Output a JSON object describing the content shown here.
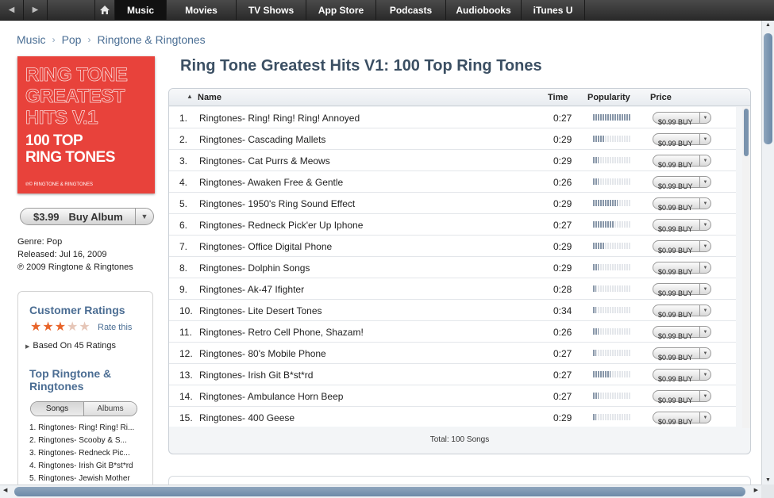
{
  "nav": {
    "back_icon": "◀",
    "forward_icon": "▶",
    "tabs": [
      {
        "label": "Music",
        "active": true
      },
      {
        "label": "Movies",
        "active": false
      },
      {
        "label": "TV Shows",
        "active": false
      },
      {
        "label": "App Store",
        "active": false
      },
      {
        "label": "Podcasts",
        "active": false
      },
      {
        "label": "Audiobooks",
        "active": false
      },
      {
        "label": "iTunes U",
        "active": false
      }
    ]
  },
  "breadcrumb": [
    "Music",
    "Pop",
    "Ringtone & Ringtones"
  ],
  "album": {
    "art_lines": [
      "RING TONE",
      "GREATEST",
      "HITS V.1",
      "100 TOP",
      "RING TONES"
    ],
    "art_small": "℗© RINGTONE & RINGTONES",
    "price": "$3.99",
    "buy_label": "Buy Album",
    "genre": "Genre: Pop",
    "released": "Released: Jul 16, 2009",
    "copyright": "℗ 2009 Ringtone & Ringtones"
  },
  "ratings": {
    "heading": "Customer Ratings",
    "stars": 3,
    "rate_link": "Rate this",
    "based_on": "Based On 45 Ratings"
  },
  "top": {
    "heading": "Top Ringtone & Ringtones",
    "seg_songs": "Songs",
    "seg_albums": "Albums",
    "items": [
      "1. Ringtones- Ring! Ring! Ri...",
      "2. Ringtones- Scooby & S...",
      "3. Ringtones- Redneck Pic...",
      "4. Ringtones- Irish Git B*st*rd",
      "5. Ringtones- Jewish Mother"
    ]
  },
  "page_title": "Ring Tone Greatest Hits V1: 100 Top Ring Tones",
  "table": {
    "headers": {
      "name": "Name",
      "time": "Time",
      "popularity": "Popularity",
      "price": "Price"
    },
    "total": "Total: 100 Songs",
    "rows": [
      {
        "num": "1.",
        "name": "Ringtones- Ring! Ring! Ring! Annoyed",
        "time": "0:27",
        "popularity": 1.0,
        "price": "$0.99 BUY"
      },
      {
        "num": "2.",
        "name": "Ringtones- Cascading Mallets",
        "time": "0:29",
        "popularity": 0.3,
        "price": "$0.99 BUY"
      },
      {
        "num": "3.",
        "name": "Ringtones- Cat Purrs & Meows",
        "time": "0:29",
        "popularity": 0.15,
        "price": "$0.99 BUY"
      },
      {
        "num": "4.",
        "name": "Ringtones- Awaken Free & Gentle",
        "time": "0:26",
        "popularity": 0.15,
        "price": "$0.99 BUY"
      },
      {
        "num": "5.",
        "name": "Ringtones- 1950's Ring Sound Effect",
        "time": "0:29",
        "popularity": 0.65,
        "price": "$0.99 BUY"
      },
      {
        "num": "6.",
        "name": "Ringtones- Redneck Pick'er Up Iphone",
        "time": "0:27",
        "popularity": 0.55,
        "price": "$0.99 BUY"
      },
      {
        "num": "7.",
        "name": "Ringtones- Office Digital Phone",
        "time": "0:29",
        "popularity": 0.3,
        "price": "$0.99 BUY"
      },
      {
        "num": "8.",
        "name": "Ringtones- Dolphin Songs",
        "time": "0:29",
        "popularity": 0.15,
        "price": "$0.99 BUY"
      },
      {
        "num": "9.",
        "name": "Ringtones- Ak-47 Ifighter",
        "time": "0:28",
        "popularity": 0.08,
        "price": "$0.99 BUY"
      },
      {
        "num": "10.",
        "name": "Ringtones- Lite Desert Tones",
        "time": "0:34",
        "popularity": 0.08,
        "price": "$0.99 BUY"
      },
      {
        "num": "11.",
        "name": "Ringtones- Retro Cell Phone, Shazam!",
        "time": "0:26",
        "popularity": 0.15,
        "price": "$0.99 BUY"
      },
      {
        "num": "12.",
        "name": "Ringtones- 80's Mobile Phone",
        "time": "0:27",
        "popularity": 0.08,
        "price": "$0.99 BUY"
      },
      {
        "num": "13.",
        "name": "Ringtones- Irish Git B*st*rd",
        "time": "0:27",
        "popularity": 0.45,
        "price": "$0.99 BUY"
      },
      {
        "num": "14.",
        "name": "Ringtones- Ambulance Horn Beep",
        "time": "0:27",
        "popularity": 0.15,
        "price": "$0.99 BUY"
      },
      {
        "num": "15.",
        "name": "Ringtones- 400 Geese",
        "time": "0:29",
        "popularity": 0.08,
        "price": "$0.99 BUY"
      }
    ]
  }
}
